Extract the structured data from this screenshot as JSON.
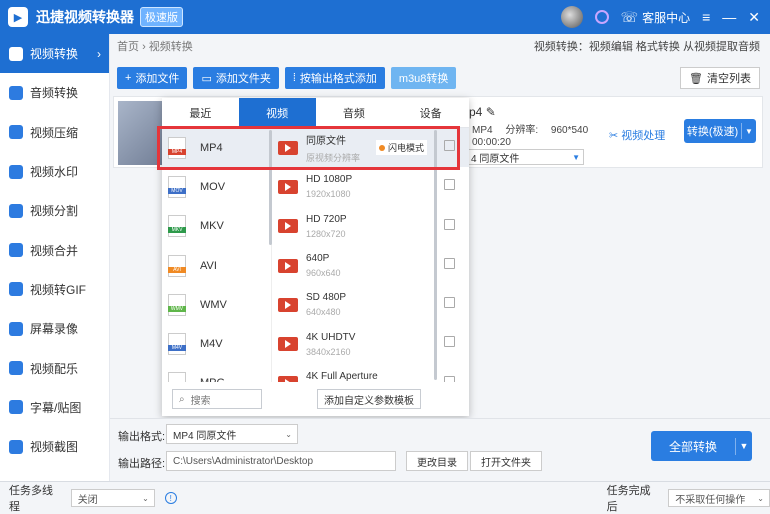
{
  "app": {
    "title": "迅捷视频转换器",
    "badge": "极速版",
    "help": "客服中心"
  },
  "sidebar": {
    "items": [
      {
        "label": "视频转换",
        "active": true
      },
      {
        "label": "音频转换"
      },
      {
        "label": "视频压缩"
      },
      {
        "label": "视频水印"
      },
      {
        "label": "视频分割"
      },
      {
        "label": "视频合并"
      },
      {
        "label": "视频转GIF"
      },
      {
        "label": "屏幕录像"
      },
      {
        "label": "视频配乐"
      },
      {
        "label": "字幕/贴图"
      },
      {
        "label": "视频截图"
      }
    ]
  },
  "breadcrumb": {
    "home": "首页",
    "sep": "›",
    "current": "视频转换"
  },
  "breadcrumb_right": "视频转换：视频编辑 格式转换 从视频提取音频",
  "toolbar": {
    "add_file": "添加文件",
    "add_folder": "添加文件夹",
    "by_format": "按输出格式添加",
    "m3u8": "m3u8转换",
    "clear": "清空列表"
  },
  "file": {
    "name": "p4",
    "format": "MP4",
    "resolution_label": "分辨率:",
    "resolution": "960*540",
    "duration": "00:00:20",
    "output_format": "4  同原文件",
    "video_process": "视频处理",
    "convert": "转换(极速)"
  },
  "popup": {
    "tabs": [
      "最近",
      "视频",
      "音频",
      "设备"
    ],
    "active_tab": 1,
    "formats": [
      {
        "name": "MP4",
        "color": "#d8432f",
        "band": "MP4"
      },
      {
        "name": "MOV",
        "color": "#3d6fc7",
        "band": "MOV"
      },
      {
        "name": "MKV",
        "color": "#2e9a4b",
        "band": "MKV"
      },
      {
        "name": "AVI",
        "color": "#f08a24",
        "band": "AVI"
      },
      {
        "name": "WMV",
        "color": "#5fb64a",
        "band": "WMV"
      },
      {
        "name": "M4V",
        "color": "#3d6fc7",
        "band": "M4V"
      },
      {
        "name": "MPG",
        "color": "#2aaaa0",
        "band": "MPG"
      }
    ],
    "resolutions": [
      {
        "name": "同原文件",
        "sub": "原视频分辨率",
        "flash": "闪电模式"
      },
      {
        "name": "HD 1080P",
        "sub": "1920x1080"
      },
      {
        "name": "HD 720P",
        "sub": "1280x720"
      },
      {
        "name": "640P",
        "sub": "960x640"
      },
      {
        "name": "SD 480P",
        "sub": "640x480"
      },
      {
        "name": "4K UHDTV",
        "sub": "3840x2160"
      },
      {
        "name": "4K Full Aperture",
        "sub": "4096x3112"
      }
    ],
    "search_placeholder": "搜索",
    "add_template": "添加自定义参数模板"
  },
  "bottom": {
    "format_label": "输出格式:",
    "format_value": "MP4  同原文件",
    "path_label": "输出路径:",
    "path_value": "C:\\Users\\Administrator\\Desktop",
    "change_dir": "更改目录",
    "open_folder": "打开文件夹",
    "convert_all": "全部转换"
  },
  "statusbar": {
    "multithread_label": "任务多线程",
    "multithread_value": "关闭",
    "done_label": "任务完成后",
    "done_value": "不采取任何操作"
  },
  "colors": {
    "accent": "#1e6fd2",
    "highlight": "#e5353a"
  }
}
